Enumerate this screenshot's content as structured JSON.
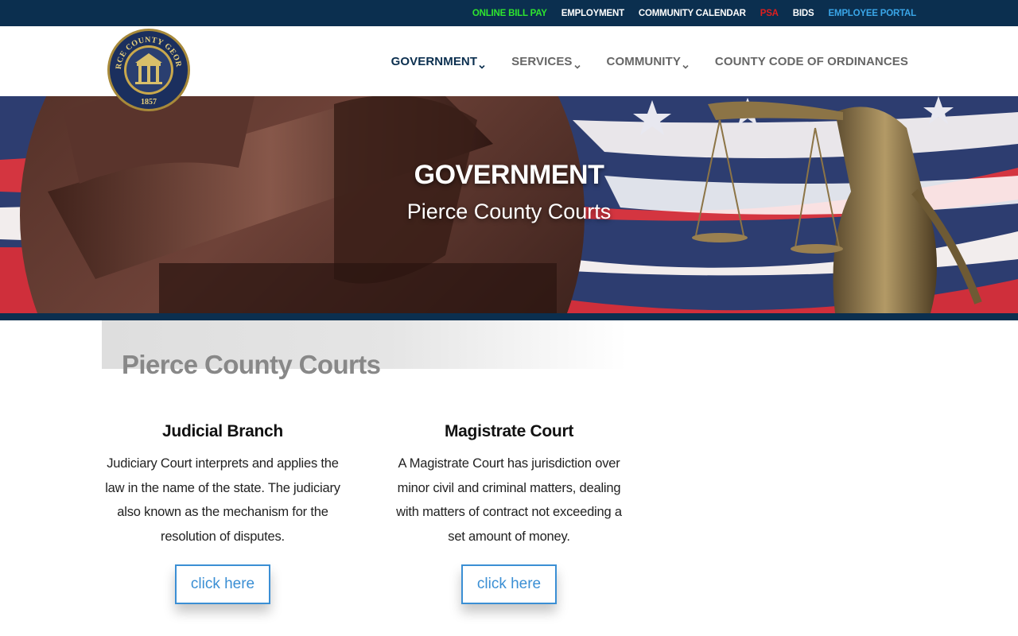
{
  "topbar": {
    "links": [
      {
        "label": "ONLINE BILL PAY",
        "color": "#2ee52e"
      },
      {
        "label": "EMPLOYMENT",
        "color": "#ffffff"
      },
      {
        "label": "COMMUNITY CALENDAR",
        "color": "#ffffff"
      },
      {
        "label": "PSA",
        "color": "#e01e1e"
      },
      {
        "label": "BIDS",
        "color": "#ffffff"
      },
      {
        "label": "EMPLOYEE PORTAL",
        "color": "#3aa6e8"
      }
    ]
  },
  "header": {
    "logo": {
      "ring_text": "PIERCE COUNTY GEORGIA",
      "year": "1857",
      "icon": "county-seal"
    },
    "nav": [
      {
        "label": "GOVERNMENT",
        "dropdown": true,
        "active": true
      },
      {
        "label": "SERVICES",
        "dropdown": true,
        "active": false
      },
      {
        "label": "COMMUNITY",
        "dropdown": true,
        "active": false
      },
      {
        "label": "COUNTY CODE OF ORDINANCES",
        "dropdown": false,
        "active": false
      }
    ]
  },
  "hero": {
    "title": "GOVERNMENT",
    "subtitle": "Pierce County Courts"
  },
  "section": {
    "title": "Pierce County Courts"
  },
  "cards": [
    {
      "title": "Judicial Branch",
      "body": "Judiciary Court interprets and applies the law in the name of the state. The judiciary also known as the mechanism for the resolution of disputes.",
      "button": "click here"
    },
    {
      "title": "Magistrate Court",
      "body": "A Magistrate Court has jurisdiction over minor civil and criminal matters, dealing with matters of contract not exceeding a set amount of money.",
      "button": "click here"
    }
  ],
  "colors": {
    "navy": "#0b2f4f",
    "accent_blue": "#3b8fd4",
    "nav_gray": "#666666",
    "heading_gray": "#888888"
  }
}
